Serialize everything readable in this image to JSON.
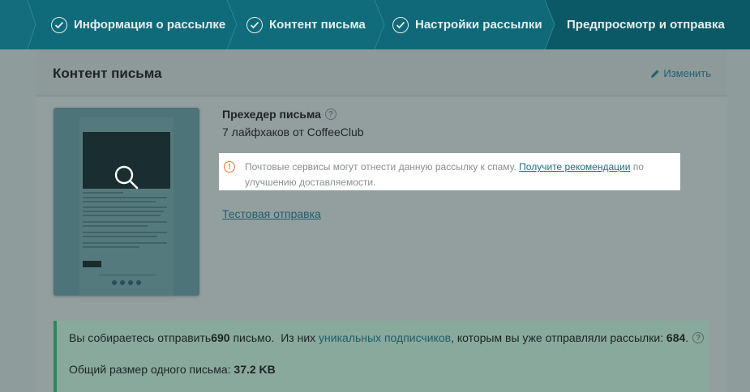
{
  "wizard": {
    "steps": [
      {
        "label": "Информация о рассылке",
        "completed": true
      },
      {
        "label": "Контент письма",
        "completed": true
      },
      {
        "label": "Настройки рассылки",
        "completed": true
      },
      {
        "label": "Предпросмотр и отправка",
        "completed": false,
        "active": true
      }
    ]
  },
  "content_card": {
    "title": "Контент письма",
    "edit_label": "Изменить",
    "preheader_label": "Прехедер письма",
    "preheader_value": "7 лайфхаков от CoffeeClub",
    "warning": {
      "text_before": "Почтовые сервисы могут отнести данную рассылку к спаму. ",
      "link": "Получите рекомендации",
      "text_after": " по улучшению доставляемости."
    },
    "test_send_label": "Тестовая отправка"
  },
  "summary": {
    "line1_prefix": "Вы собираетесь отправить ",
    "count": "690",
    "line1_mid": " письмо.  Из них ",
    "unique_link": "уникальных подписчиков",
    "line1_suffix": ", которым вы уже отправляли рассылки: ",
    "unique_count": "684",
    "line1_end": ".",
    "size_label": "Общий размер одного письма: ",
    "size_value": "37.2 KB"
  },
  "colors": {
    "header_bg": "#0e6676",
    "active_step_bg": "#0b5866",
    "warning_icon": "#e07a35",
    "success_border": "#2a8a56",
    "link": "#1d6f82"
  }
}
